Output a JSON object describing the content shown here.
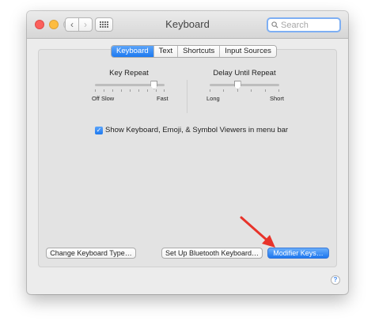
{
  "window": {
    "title": "Keyboard"
  },
  "search": {
    "placeholder": "Search"
  },
  "tabs": [
    "Keyboard",
    "Text",
    "Shortcuts",
    "Input Sources"
  ],
  "key_repeat": {
    "title": "Key Repeat",
    "min_label": "Off Slow",
    "max_label": "Fast",
    "value": 0.85
  },
  "delay_until_repeat": {
    "title": "Delay Until Repeat",
    "min_label": "Long",
    "max_label": "Short",
    "value": 0.4
  },
  "checkbox": {
    "label": "Show Keyboard, Emoji, & Symbol Viewers in menu bar",
    "checked": true
  },
  "buttons": {
    "change_type": "Change Keyboard Type…",
    "bluetooth": "Set Up Bluetooth Keyboard…",
    "modifier": "Modifier Keys…"
  },
  "help": {
    "label": "?"
  },
  "colors": {
    "accent": "#1d79f0",
    "annotation_arrow": "#e8332a",
    "close": "#fc605c",
    "minimize": "#fdbc40"
  },
  "icons": [
    "back-arrow-icon",
    "forward-arrow-icon",
    "grid-icon",
    "search-icon",
    "checkmark-icon",
    "help-icon",
    "red-arrow-icon"
  ]
}
